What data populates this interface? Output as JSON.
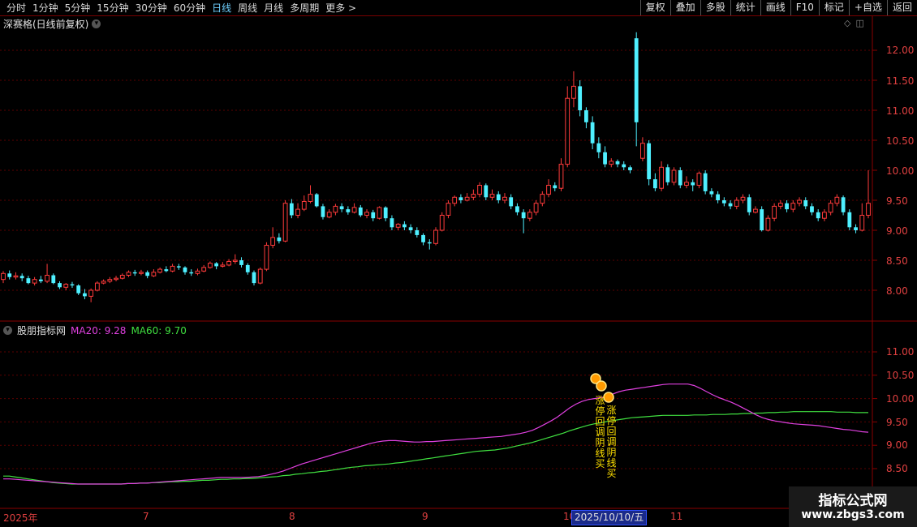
{
  "toolbar": {
    "periods": [
      "分时",
      "1分钟",
      "5分钟",
      "15分钟",
      "30分钟",
      "60分钟",
      "日线",
      "周线",
      "月线",
      "多周期",
      "更多 >"
    ],
    "active_period": "日线",
    "actions": [
      "复权",
      "叠加",
      "多股",
      "统计",
      "画线",
      "F10",
      "标记",
      "+自选",
      "返回"
    ]
  },
  "main": {
    "title": "深赛格(日线前复权)",
    "y_ticks": [
      "12.00",
      "11.50",
      "11.00",
      "10.50",
      "10.00",
      "9.50",
      "9.00",
      "8.50",
      "8.00"
    ]
  },
  "indicator": {
    "name": "股朋指标网",
    "ma20_label": "MA20: 9.28",
    "ma60_label": "MA60: 9.70",
    "y_ticks": [
      "11.00",
      "10.50",
      "10.00",
      "9.50",
      "9.00",
      "8.50"
    ],
    "signals": [
      {
        "text": "涨停回调阴线买"
      },
      {
        "text": "涨停回调阴线买"
      }
    ]
  },
  "dates": {
    "labels": [
      "2025年",
      "7",
      "8",
      "9",
      "10",
      "11"
    ],
    "cursor": "2025/10/10/五"
  },
  "watermark": {
    "line1": "指标公式网",
    "line2": "www.zbgs3.com"
  },
  "colors": {
    "up": "#ff3b3b",
    "down": "#4ff0ff",
    "ma20": "#e040e0",
    "ma60": "#40e040",
    "signal": "#ffe000"
  },
  "chart_data": {
    "type": "candlestick",
    "candles": [
      [
        8.18,
        8.28,
        8.32,
        8.12
      ],
      [
        8.28,
        8.22,
        8.33,
        8.18
      ],
      [
        8.22,
        8.24,
        8.3,
        8.18
      ],
      [
        8.24,
        8.2,
        8.28,
        8.15
      ],
      [
        8.2,
        8.12,
        8.24,
        8.1
      ],
      [
        8.12,
        8.18,
        8.22,
        8.08
      ],
      [
        8.18,
        8.15,
        8.24,
        8.12
      ],
      [
        8.15,
        8.25,
        8.44,
        8.12
      ],
      [
        8.25,
        8.12,
        8.28,
        8.1
      ],
      [
        8.12,
        8.05,
        8.15,
        8.02
      ],
      [
        8.05,
        8.1,
        8.12,
        8.0
      ],
      [
        8.1,
        8.08,
        8.14,
        8.04
      ],
      [
        8.08,
        7.95,
        8.1,
        7.92
      ],
      [
        7.95,
        7.9,
        8.02,
        7.85
      ],
      [
        7.9,
        8.0,
        8.03,
        7.8
      ],
      [
        8.0,
        8.12,
        8.15,
        7.98
      ],
      [
        8.12,
        8.15,
        8.18,
        8.1
      ],
      [
        8.15,
        8.18,
        8.22,
        8.12
      ],
      [
        8.18,
        8.2,
        8.24,
        8.15
      ],
      [
        8.2,
        8.25,
        8.28,
        8.18
      ],
      [
        8.25,
        8.3,
        8.33,
        8.22
      ],
      [
        8.3,
        8.28,
        8.34,
        8.24
      ],
      [
        8.28,
        8.3,
        8.34,
        8.25
      ],
      [
        8.3,
        8.24,
        8.33,
        8.2
      ],
      [
        8.24,
        8.3,
        8.35,
        8.22
      ],
      [
        8.3,
        8.35,
        8.38,
        8.28
      ],
      [
        8.35,
        8.32,
        8.4,
        8.3
      ],
      [
        8.32,
        8.4,
        8.44,
        8.3
      ],
      [
        8.4,
        8.38,
        8.44,
        8.34
      ],
      [
        8.38,
        8.3,
        8.4,
        8.26
      ],
      [
        8.3,
        8.28,
        8.35,
        8.24
      ],
      [
        8.28,
        8.32,
        8.36,
        8.25
      ],
      [
        8.32,
        8.38,
        8.42,
        8.3
      ],
      [
        8.38,
        8.45,
        8.48,
        8.36
      ],
      [
        8.45,
        8.4,
        8.47,
        8.35
      ],
      [
        8.4,
        8.42,
        8.47,
        8.38
      ],
      [
        8.42,
        8.48,
        8.52,
        8.4
      ],
      [
        8.48,
        8.5,
        8.6,
        8.44
      ],
      [
        8.5,
        8.42,
        8.55,
        8.38
      ],
      [
        8.42,
        8.3,
        8.45,
        8.26
      ],
      [
        8.3,
        8.12,
        8.33,
        8.08
      ],
      [
        8.12,
        8.35,
        8.38,
        8.1
      ],
      [
        8.35,
        8.75,
        8.8,
        8.32
      ],
      [
        8.75,
        8.88,
        9.05,
        8.7
      ],
      [
        8.88,
        8.82,
        8.95,
        8.78
      ],
      [
        8.82,
        9.45,
        9.5,
        8.8
      ],
      [
        9.45,
        9.25,
        9.52,
        9.2
      ],
      [
        9.25,
        9.35,
        9.45,
        9.2
      ],
      [
        9.35,
        9.48,
        9.58,
        9.32
      ],
      [
        9.48,
        9.6,
        9.75,
        9.45
      ],
      [
        9.6,
        9.4,
        9.62,
        9.38
      ],
      [
        9.4,
        9.22,
        9.44,
        9.18
      ],
      [
        9.22,
        9.3,
        9.35,
        9.2
      ],
      [
        9.3,
        9.4,
        9.44,
        9.25
      ],
      [
        9.4,
        9.35,
        9.45,
        9.3
      ],
      [
        9.35,
        9.3,
        9.4,
        9.26
      ],
      [
        9.3,
        9.38,
        9.45,
        9.28
      ],
      [
        9.38,
        9.25,
        9.42,
        9.22
      ],
      [
        9.25,
        9.3,
        9.35,
        9.2
      ],
      [
        9.3,
        9.2,
        9.34,
        9.15
      ],
      [
        9.2,
        9.38,
        9.4,
        9.18
      ],
      [
        9.38,
        9.2,
        9.4,
        9.15
      ],
      [
        9.2,
        9.05,
        9.25,
        9.0
      ],
      [
        9.05,
        9.1,
        9.12,
        9.0
      ],
      [
        9.1,
        9.05,
        9.15,
        9.0
      ],
      [
        9.05,
        9.0,
        9.1,
        8.95
      ],
      [
        9.0,
        8.92,
        9.05,
        8.88
      ],
      [
        8.92,
        8.8,
        8.95,
        8.75
      ],
      [
        8.8,
        8.78,
        8.85,
        8.68
      ],
      [
        8.78,
        9.0,
        9.05,
        8.75
      ],
      [
        9.0,
        9.25,
        9.3,
        8.98
      ],
      [
        9.25,
        9.45,
        9.5,
        9.2
      ],
      [
        9.45,
        9.55,
        9.58,
        9.4
      ],
      [
        9.55,
        9.5,
        9.6,
        9.45
      ],
      [
        9.5,
        9.55,
        9.62,
        9.48
      ],
      [
        9.55,
        9.6,
        9.68,
        9.5
      ],
      [
        9.6,
        9.75,
        9.8,
        9.55
      ],
      [
        9.75,
        9.55,
        9.78,
        9.5
      ],
      [
        9.55,
        9.6,
        9.68,
        9.5
      ],
      [
        9.6,
        9.5,
        9.65,
        9.45
      ],
      [
        9.5,
        9.55,
        9.62,
        9.45
      ],
      [
        9.55,
        9.4,
        9.6,
        9.35
      ],
      [
        9.4,
        9.3,
        9.45,
        9.25
      ],
      [
        9.3,
        9.2,
        9.35,
        8.95
      ],
      [
        9.2,
        9.3,
        9.35,
        9.15
      ],
      [
        9.3,
        9.45,
        9.5,
        9.25
      ],
      [
        9.45,
        9.6,
        9.65,
        9.4
      ],
      [
        9.6,
        9.75,
        9.85,
        9.55
      ],
      [
        9.75,
        9.7,
        9.8,
        9.65
      ],
      [
        9.7,
        10.1,
        10.2,
        9.65
      ],
      [
        10.1,
        11.2,
        11.4,
        10.05
      ],
      [
        11.2,
        11.4,
        11.65,
        11.05
      ],
      [
        11.4,
        11.0,
        11.5,
        10.9
      ],
      [
        11.0,
        10.8,
        11.05,
        10.7
      ],
      [
        10.8,
        10.45,
        10.9,
        10.35
      ],
      [
        10.45,
        10.3,
        10.55,
        10.2
      ],
      [
        10.3,
        10.1,
        10.4,
        10.05
      ],
      [
        10.1,
        10.15,
        10.2,
        10.05
      ],
      [
        10.15,
        10.1,
        10.18,
        10.05
      ],
      [
        10.1,
        10.05,
        10.15,
        10.0
      ],
      [
        10.05,
        10.0,
        10.08,
        9.95
      ],
      [
        12.2,
        10.8,
        12.3,
        10.4
      ],
      [
        10.2,
        10.45,
        10.55,
        10.15
      ],
      [
        10.45,
        9.85,
        10.5,
        9.75
      ],
      [
        9.85,
        9.7,
        9.95,
        9.65
      ],
      [
        9.7,
        10.05,
        10.15,
        9.65
      ],
      [
        10.05,
        9.8,
        10.1,
        9.75
      ],
      [
        9.8,
        10.0,
        10.05,
        9.75
      ],
      [
        10.0,
        9.75,
        10.05,
        9.7
      ],
      [
        9.75,
        9.8,
        9.9,
        9.7
      ],
      [
        9.8,
        9.75,
        9.85,
        9.65
      ],
      [
        9.75,
        9.95,
        9.98,
        9.7
      ],
      [
        9.95,
        9.65,
        10.0,
        9.6
      ],
      [
        9.65,
        9.6,
        9.7,
        9.55
      ],
      [
        9.6,
        9.5,
        9.65,
        9.45
      ],
      [
        9.5,
        9.45,
        9.55,
        9.4
      ],
      [
        9.45,
        9.4,
        9.5,
        9.35
      ],
      [
        9.4,
        9.5,
        9.55,
        9.35
      ],
      [
        9.5,
        9.55,
        9.6,
        9.45
      ],
      [
        9.55,
        9.3,
        9.6,
        9.25
      ],
      [
        9.3,
        9.35,
        9.4,
        9.28
      ],
      [
        9.35,
        9.0,
        9.4,
        8.98
      ],
      [
        9.0,
        9.2,
        9.25,
        8.98
      ],
      [
        9.2,
        9.4,
        9.45,
        9.15
      ],
      [
        9.4,
        9.45,
        9.5,
        9.35
      ],
      [
        9.45,
        9.35,
        9.5,
        9.3
      ],
      [
        9.35,
        9.45,
        9.5,
        9.3
      ],
      [
        9.45,
        9.5,
        9.55,
        9.4
      ],
      [
        9.5,
        9.4,
        9.55,
        9.35
      ],
      [
        9.4,
        9.3,
        9.45,
        9.25
      ],
      [
        9.3,
        9.2,
        9.35,
        9.15
      ],
      [
        9.2,
        9.3,
        9.35,
        9.15
      ],
      [
        9.3,
        9.45,
        9.5,
        9.25
      ],
      [
        9.45,
        9.55,
        9.6,
        9.4
      ],
      [
        9.55,
        9.3,
        9.58,
        9.25
      ],
      [
        9.3,
        9.05,
        9.35,
        9.0
      ],
      [
        9.05,
        9.0,
        9.1,
        8.95
      ],
      [
        9.0,
        9.25,
        9.45,
        8.98
      ],
      [
        9.25,
        9.45,
        10.0,
        9.2
      ]
    ],
    "ma20": [
      8.28,
      8.28,
      8.27,
      8.26,
      8.25,
      8.24,
      8.23,
      8.22,
      8.21,
      8.2,
      8.19,
      8.18,
      8.17,
      8.17,
      8.17,
      8.17,
      8.17,
      8.17,
      8.17,
      8.17,
      8.18,
      8.18,
      8.19,
      8.19,
      8.2,
      8.21,
      8.22,
      8.23,
      8.24,
      8.25,
      8.26,
      8.27,
      8.28,
      8.29,
      8.3,
      8.31,
      8.31,
      8.31,
      8.31,
      8.31,
      8.32,
      8.33,
      8.35,
      8.38,
      8.41,
      8.45,
      8.5,
      8.55,
      8.6,
      8.64,
      8.68,
      8.72,
      8.76,
      8.8,
      8.84,
      8.88,
      8.92,
      8.96,
      9.0,
      9.04,
      9.07,
      9.09,
      9.1,
      9.1,
      9.09,
      9.08,
      9.07,
      9.07,
      9.08,
      9.08,
      9.09,
      9.1,
      9.11,
      9.12,
      9.13,
      9.14,
      9.15,
      9.16,
      9.17,
      9.18,
      9.19,
      9.21,
      9.23,
      9.25,
      9.28,
      9.32,
      9.38,
      9.45,
      9.52,
      9.6,
      9.7,
      9.8,
      9.88,
      9.94,
      9.98,
      10.0,
      10.02,
      10.05,
      10.1,
      10.15,
      10.18,
      10.2,
      10.22,
      10.24,
      10.26,
      10.28,
      10.3,
      10.31,
      10.31,
      10.31,
      10.31,
      10.28,
      10.22,
      10.15,
      10.08,
      10.02,
      9.97,
      9.92,
      9.86,
      9.79,
      9.72,
      9.65,
      9.59,
      9.55,
      9.52,
      9.5,
      9.48,
      9.46,
      9.45,
      9.44,
      9.43,
      9.42,
      9.4,
      9.38,
      9.36,
      9.34,
      9.33,
      9.31,
      9.29,
      9.28
    ],
    "ma60": [
      8.34,
      8.34,
      8.32,
      8.3,
      8.28,
      8.26,
      8.24,
      8.22,
      8.2,
      8.19,
      8.18,
      8.17,
      8.17,
      8.17,
      8.17,
      8.17,
      8.17,
      8.17,
      8.17,
      8.17,
      8.18,
      8.18,
      8.19,
      8.19,
      8.2,
      8.2,
      8.21,
      8.22,
      8.22,
      8.23,
      8.23,
      8.24,
      8.25,
      8.25,
      8.26,
      8.27,
      8.27,
      8.28,
      8.28,
      8.29,
      8.29,
      8.3,
      8.31,
      8.32,
      8.33,
      8.35,
      8.36,
      8.38,
      8.39,
      8.41,
      8.42,
      8.44,
      8.45,
      8.47,
      8.49,
      8.51,
      8.53,
      8.54,
      8.56,
      8.57,
      8.58,
      8.59,
      8.6,
      8.62,
      8.63,
      8.65,
      8.67,
      8.69,
      8.71,
      8.73,
      8.75,
      8.77,
      8.79,
      8.81,
      8.83,
      8.85,
      8.87,
      8.88,
      8.89,
      8.9,
      8.92,
      8.94,
      8.97,
      9.0,
      9.03,
      9.06,
      9.1,
      9.14,
      9.18,
      9.22,
      9.26,
      9.31,
      9.35,
      9.39,
      9.43,
      9.46,
      9.48,
      9.51,
      9.53,
      9.55,
      9.57,
      9.59,
      9.6,
      9.61,
      9.62,
      9.63,
      9.64,
      9.64,
      9.64,
      9.64,
      9.64,
      9.65,
      9.65,
      9.65,
      9.66,
      9.66,
      9.66,
      9.67,
      9.67,
      9.68,
      9.68,
      9.69,
      9.69,
      9.7,
      9.7,
      9.71,
      9.71,
      9.72,
      9.72,
      9.72,
      9.72,
      9.72,
      9.72,
      9.72,
      9.71,
      9.71,
      9.71,
      9.7,
      9.7,
      9.7
    ]
  }
}
